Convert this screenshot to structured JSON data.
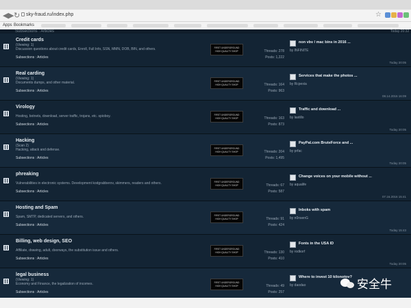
{
  "browser": {
    "url": "sky-fraud.ru/index.php",
    "nav": {
      "back": "◀",
      "forward": "▶",
      "reload": "↻"
    },
    "bookmark_icon": "☆",
    "extension_colors": [
      "#5b8fd6",
      "#e7b24a",
      "#c46ad1",
      "#6cc07a",
      "#e57373"
    ],
    "bookmarks": {
      "apps_label": "Apps",
      "bookmarks_label": "Bookmarks"
    }
  },
  "top_strip": {
    "text": "Subsections : Articles",
    "date": "Today 20:32"
  },
  "forums": [
    {
      "title": "Credit cards",
      "viewing": "(Viewing: 1)",
      "description": "Discussion questions about credit cards, Enroll, Full Info, SSN, MMN, DOB, BIN, and others.",
      "subsections": "Subsections : Articles",
      "banner": [
        "FIRST UNDERGROUND",
        "HIGH QUALITY SHOP"
      ],
      "threads": "Threads: 278",
      "posts": "Posts: 1,222",
      "last_post_title": "non vbv / mac bins in 2016 ...",
      "last_post_by": "by INFINITE",
      "last_post_date": "Today 20:05"
    },
    {
      "title": "Real carding",
      "viewing": "(Viewing: 1)",
      "description": "Documents dumps, and other material.",
      "subsections": "Subsections : Articles",
      "banner": [
        "FIRST UNDERGROUND",
        "HIGH QUALITY SHOP"
      ],
      "threads": "Threads: 164",
      "posts": "Posts: 963",
      "last_post_title": "Services that make the photos ...",
      "last_post_by": "by Rcpexia",
      "last_post_date": "08.14.2016 16:09"
    },
    {
      "title": "Virology",
      "viewing": "",
      "description": "Hosting, botnets, download, server traffic, trojans, etc. spioboy.",
      "subsections": "Subsections : Articles",
      "banner": [
        "FIRST UNDERGROUND",
        "HIGH QUALITY SHOP"
      ],
      "threads": "Threads: 163",
      "posts": "Posts: 873",
      "last_post_title": "Traffic and download ...",
      "last_post_by": "by lastillo",
      "last_post_date": "Today 20:05"
    },
    {
      "title": "Hacking",
      "viewing": "(Scan 2)",
      "description": "Hacking, attack and defense.",
      "subsections": "Subsections : Articles",
      "banner": [
        "FIRST UNDERGROUND",
        "HIGH QUALITY SHOP"
      ],
      "threads": "Threads: 204",
      "posts": "Posts: 1,495",
      "last_post_title": "PayPal.com BruteForce and ...",
      "last_post_by": "by prfac",
      "last_post_date": "Today 20:05"
    },
    {
      "title": "phreaking",
      "viewing": "",
      "description": "Vulnerabilities in electronic systems. Development kodgrabberov, skimmers, readers and others.",
      "subsections": "Subsections : Articles",
      "banner": [
        "FIRST UNDERGROUND",
        "HIGH QUALITY SHOP"
      ],
      "threads": "Threads: 67",
      "posts": "Posts: 587",
      "last_post_title": "Change voices on your mobile without ...",
      "last_post_by": "by aqualife",
      "last_post_date": "07.16.2016 15:41"
    },
    {
      "title": "Hosting and Spam",
      "viewing": "",
      "description": "Spam, SMTP, dedicated servers, and others.",
      "subsections": "Subsections : Articles",
      "banner": [
        "FIRST UNDERGROUND",
        "HIGH QUALITY SHOP"
      ],
      "threads": "Threads: 91",
      "posts": "Posts: 424",
      "last_post_title": "Inboks with spam",
      "last_post_by": "by n0nsenG",
      "last_post_date": "Today 15:43"
    },
    {
      "title": "Billing, web design, SEO",
      "viewing": "",
      "description": "Affiliate, drawing, adult, doorways, the substitution issue and others.",
      "subsections": "Subsections : Articles",
      "banner": [
        "FIRST UNDERGROUND",
        "HIGH QUALITY SHOP"
      ],
      "threads": "Threads: 130",
      "posts": "Posts: 410",
      "last_post_title": "Fonts in the USA ID",
      "last_post_by": "by rodkorf",
      "last_post_date": "Today 20:05"
    },
    {
      "title": "legal business",
      "viewing": "(Viewing: 1)",
      "description": "Economy and Finance, the legalization of incomes.",
      "subsections": "Subsections : Articles",
      "banner": [
        "FIRST UNDERGROUND",
        "HIGH QUALITY SHOP"
      ],
      "threads": "Threads: 49",
      "posts": "Posts: 257",
      "last_post_title": "Where to invest 10 kilonotov?",
      "last_post_by": "by daodao",
      "last_post_date": ""
    }
  ],
  "watermark": {
    "text": "安全牛"
  }
}
